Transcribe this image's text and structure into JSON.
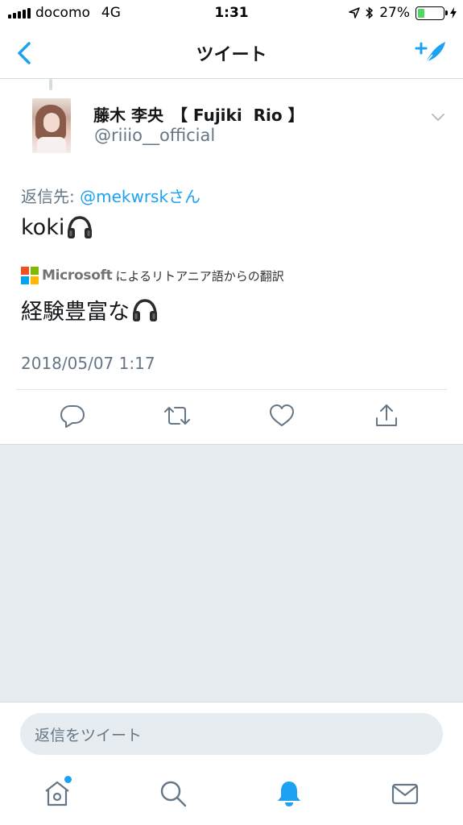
{
  "status_bar": {
    "carrier": "docomo",
    "network": "4G",
    "time": "1:31",
    "battery_percent": "27%",
    "battery_level": 0.27
  },
  "nav": {
    "title": "ツイート",
    "back_icon": "chevron-left-icon",
    "compose_icon": "compose-tweet-icon"
  },
  "tweet": {
    "display_name": "藤木 李央　【 Fujiki  Rio 】",
    "handle": "@riiio__official",
    "reply_prefix": "返信先: ",
    "reply_mention": "@mekwrskさん",
    "text": "koki",
    "text_emoji": "headphones-icon",
    "translation": {
      "provider": "Microsoft",
      "label": "によるリトアニア語からの翻訳",
      "text": "経験豊富な"
    },
    "timestamp": "2018/05/07 1:17",
    "actions": [
      "reply-icon",
      "retweet-icon",
      "like-icon",
      "share-icon"
    ]
  },
  "reply_bar": {
    "placeholder": "返信をツイート"
  },
  "tab_bar": {
    "tabs": [
      "home-icon",
      "search-icon",
      "notifications-icon",
      "messages-icon"
    ],
    "active": "notifications-icon"
  },
  "colors": {
    "accent": "#1da1f2",
    "text": "#14171a",
    "secondary": "#657786",
    "background_gray": "#e6ecf0"
  }
}
